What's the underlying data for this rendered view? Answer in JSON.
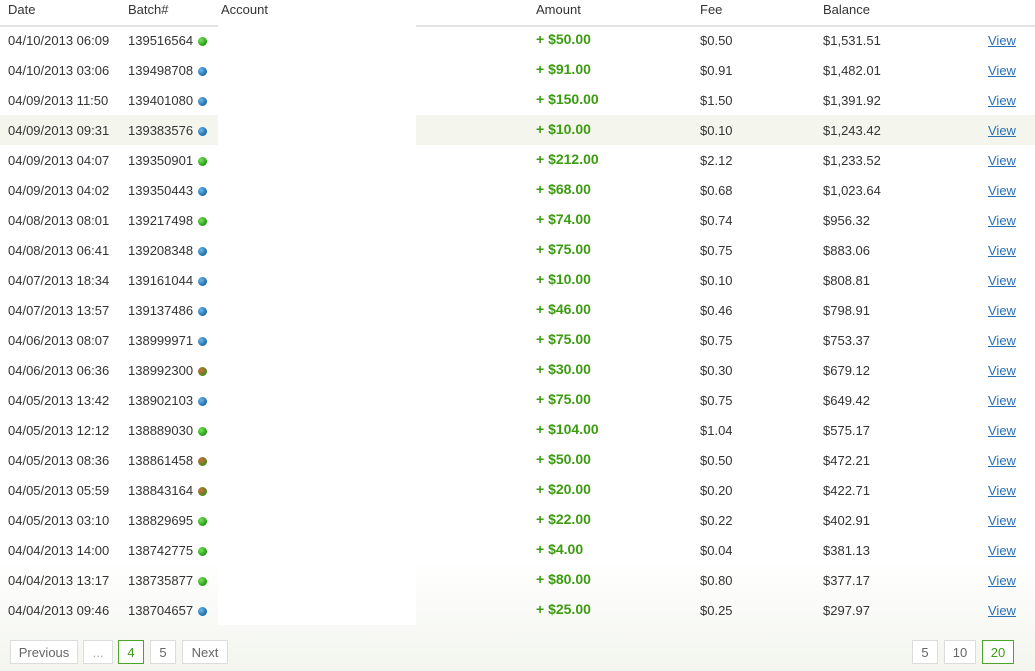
{
  "columns": {
    "date": "Date",
    "batch": "Batch#",
    "account": "Account",
    "amount": "Amount",
    "fee": "Fee",
    "balance": "Balance"
  },
  "status_colors": {
    "green": "#1f9a12",
    "blue": "#1c6aa8",
    "red": "#c8582a"
  },
  "rows": [
    {
      "date": "04/10/2013 06:09",
      "batch": "139516564",
      "status": "green",
      "amount": "+ $50.00",
      "fee": "$0.50",
      "balance": "$1,531.51",
      "action": "View"
    },
    {
      "date": "04/10/2013 03:06",
      "batch": "139498708",
      "status": "blue",
      "amount": "+ $91.00",
      "fee": "$0.91",
      "balance": "$1,482.01",
      "action": "View"
    },
    {
      "date": "04/09/2013 11:50",
      "batch": "139401080",
      "status": "blue",
      "amount": "+ $150.00",
      "fee": "$1.50",
      "balance": "$1,391.92",
      "action": "View"
    },
    {
      "date": "04/09/2013 09:31",
      "batch": "139383576",
      "status": "blue",
      "amount": "+ $10.00",
      "fee": "$0.10",
      "balance": "$1,243.42",
      "action": "View",
      "highlight": true
    },
    {
      "date": "04/09/2013 04:07",
      "batch": "139350901",
      "status": "green",
      "amount": "+ $212.00",
      "fee": "$2.12",
      "balance": "$1,233.52",
      "action": "View"
    },
    {
      "date": "04/09/2013 04:02",
      "batch": "139350443",
      "status": "blue",
      "amount": "+ $68.00",
      "fee": "$0.68",
      "balance": "$1,023.64",
      "action": "View"
    },
    {
      "date": "04/08/2013 08:01",
      "batch": "139217498",
      "status": "green",
      "amount": "+ $74.00",
      "fee": "$0.74",
      "balance": "$956.32",
      "action": "View"
    },
    {
      "date": "04/08/2013 06:41",
      "batch": "139208348",
      "status": "blue",
      "amount": "+ $75.00",
      "fee": "$0.75",
      "balance": "$883.06",
      "action": "View"
    },
    {
      "date": "04/07/2013 18:34",
      "batch": "139161044",
      "status": "blue",
      "amount": "+ $10.00",
      "fee": "$0.10",
      "balance": "$808.81",
      "action": "View"
    },
    {
      "date": "04/07/2013 13:57",
      "batch": "139137486",
      "status": "blue",
      "amount": "+ $46.00",
      "fee": "$0.46",
      "balance": "$798.91",
      "action": "View"
    },
    {
      "date": "04/06/2013 08:07",
      "batch": "138999971",
      "status": "blue",
      "amount": "+ $75.00",
      "fee": "$0.75",
      "balance": "$753.37",
      "action": "View"
    },
    {
      "date": "04/06/2013 06:36",
      "batch": "138992300",
      "status": "red",
      "amount": "+ $30.00",
      "fee": "$0.30",
      "balance": "$679.12",
      "action": "View"
    },
    {
      "date": "04/05/2013 13:42",
      "batch": "138902103",
      "status": "blue",
      "amount": "+ $75.00",
      "fee": "$0.75",
      "balance": "$649.42",
      "action": "View"
    },
    {
      "date": "04/05/2013 12:12",
      "batch": "138889030",
      "status": "green",
      "amount": "+ $104.00",
      "fee": "$1.04",
      "balance": "$575.17",
      "action": "View"
    },
    {
      "date": "04/05/2013 08:36",
      "batch": "138861458",
      "status": "red",
      "amount": "+ $50.00",
      "fee": "$0.50",
      "balance": "$472.21",
      "action": "View"
    },
    {
      "date": "04/05/2013 05:59",
      "batch": "138843164",
      "status": "red",
      "amount": "+ $20.00",
      "fee": "$0.20",
      "balance": "$422.71",
      "action": "View"
    },
    {
      "date": "04/05/2013 03:10",
      "batch": "138829695",
      "status": "green",
      "amount": "+ $22.00",
      "fee": "$0.22",
      "balance": "$402.91",
      "action": "View"
    },
    {
      "date": "04/04/2013 14:00",
      "batch": "138742775",
      "status": "green",
      "amount": "+ $4.00",
      "fee": "$0.04",
      "balance": "$381.13",
      "action": "View"
    },
    {
      "date": "04/04/2013 13:17",
      "batch": "138735877",
      "status": "green",
      "amount": "+ $80.00",
      "fee": "$0.80",
      "balance": "$377.17",
      "action": "View"
    },
    {
      "date": "04/04/2013 09:46",
      "batch": "138704657",
      "status": "blue",
      "amount": "+ $25.00",
      "fee": "$0.25",
      "balance": "$297.97",
      "action": "View"
    }
  ],
  "pagination": {
    "previous": "Previous",
    "ellipsis": "...",
    "page_current": "4",
    "page_next": "5",
    "next": "Next"
  },
  "page_sizes": {
    "options": [
      "5",
      "10",
      "20"
    ],
    "selected": "20"
  }
}
